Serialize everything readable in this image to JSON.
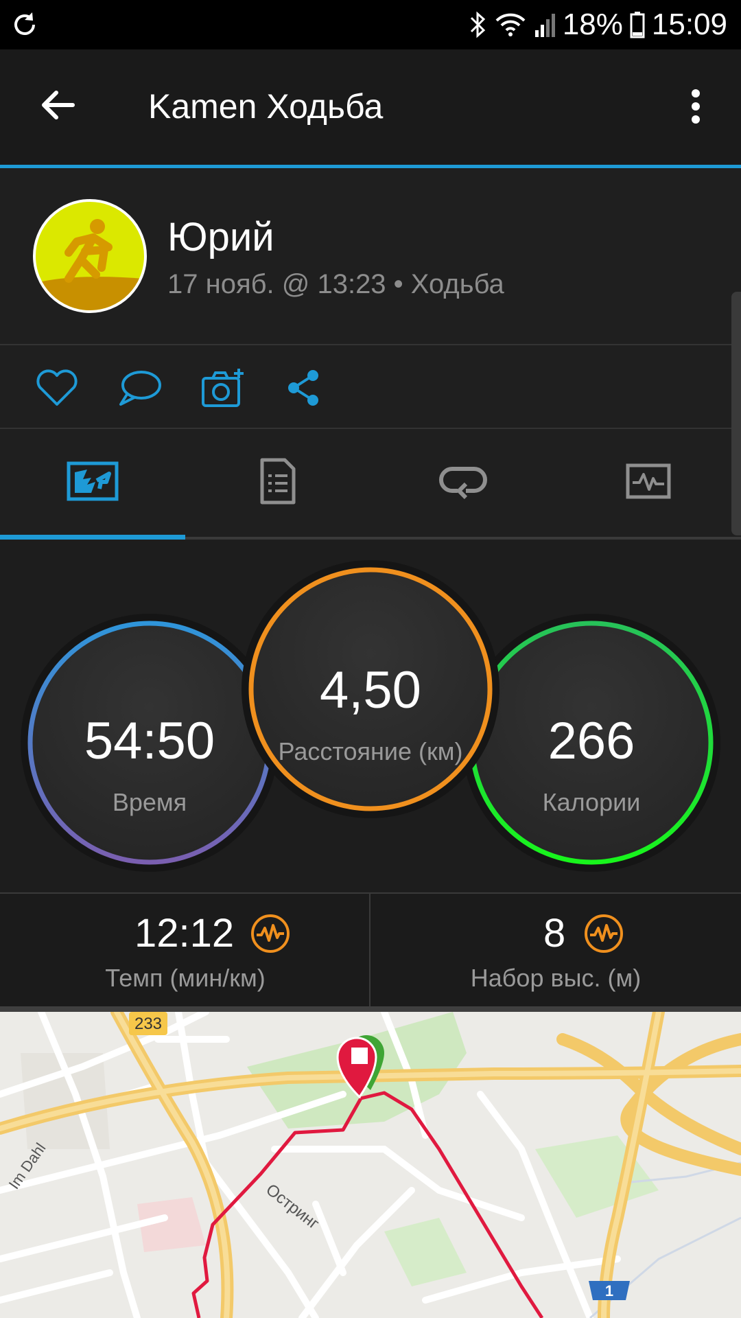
{
  "status_bar": {
    "battery": "18%",
    "time": "15:09",
    "icons": [
      "sync-icon",
      "bluetooth-icon",
      "wifi-icon",
      "signal-icon",
      "battery-icon"
    ]
  },
  "app_bar": {
    "title": "Kamen Ходьба",
    "back_icon": "arrow-left-icon",
    "menu_icon": "more-vert-icon"
  },
  "profile": {
    "name": "Юрий",
    "meta": "17 нояб. @ 13:23 • Ходьба",
    "avatar_icon": "runner-icon"
  },
  "actions": {
    "icons": [
      "heart-icon",
      "comment-icon",
      "add-photo-icon",
      "share-icon"
    ]
  },
  "tabs": {
    "active": 0,
    "icons": [
      "overview-icon",
      "details-icon",
      "laps-icon",
      "charts-icon"
    ]
  },
  "stats": {
    "time": {
      "value": "54:50",
      "label": "Время"
    },
    "distance": {
      "value": "4,50",
      "label": "Расстояние (км)"
    },
    "calories": {
      "value": "266",
      "label": "Калории"
    }
  },
  "metrics": {
    "pace": {
      "value": "12:12",
      "label": "Темп (мин/км)",
      "icon": "pulse-icon"
    },
    "elevation": {
      "value": "8",
      "label": "Набор выс. (м)",
      "icon": "pulse-icon"
    }
  },
  "map": {
    "road_shield": "233",
    "highway_shield": "1",
    "street_labels": [
      "Im Dahl",
      "Остринг"
    ]
  },
  "colors": {
    "accent": "#1e9ad6",
    "orange": "#f0901e",
    "green": "#22d64a",
    "route": "#e0193f"
  }
}
